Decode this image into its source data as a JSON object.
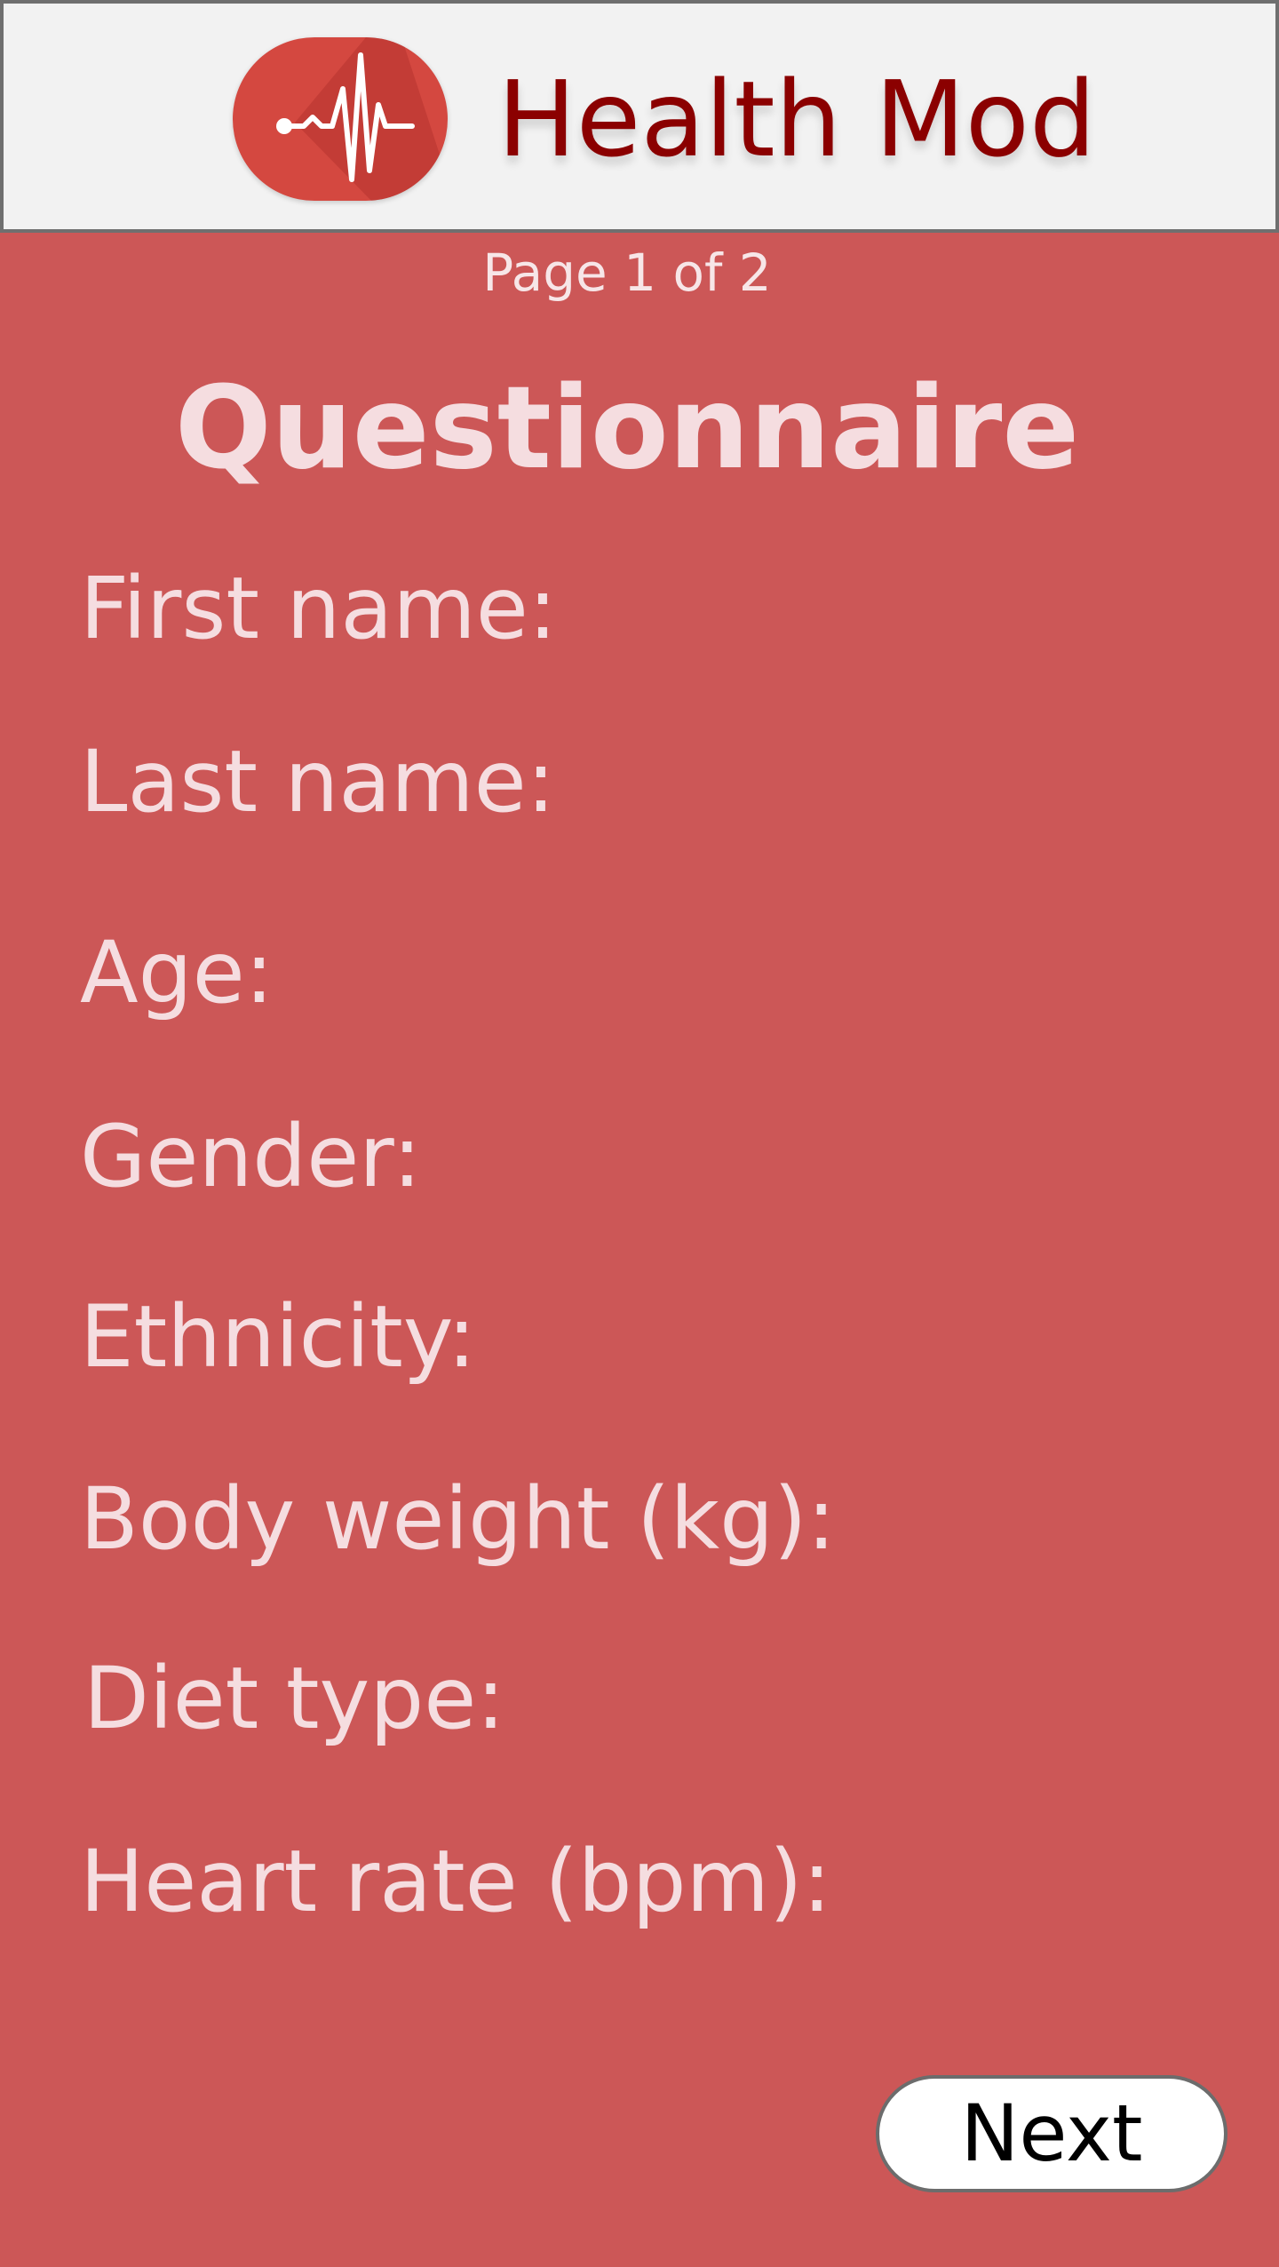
{
  "header": {
    "app_title": "Health Mod",
    "logo_icon": "heartbeat-icon"
  },
  "page": {
    "indicator": "Page 1 of 2",
    "title": "Questionnaire"
  },
  "fields": {
    "first_name": "First name:",
    "last_name": "Last name:",
    "age": "Age:",
    "gender": "Gender:",
    "ethnicity": "Ethnicity:",
    "body_weight": "Body weight (kg):",
    "diet_type": "Diet type:",
    "heart_rate": "Heart rate (bpm):"
  },
  "actions": {
    "next_label": "Next"
  },
  "colors": {
    "background": "#cc5757",
    "header_background": "#f2f2f2",
    "title_color": "#8b0000",
    "logo_color": "#d44840",
    "label_color": "#f5dde0"
  }
}
